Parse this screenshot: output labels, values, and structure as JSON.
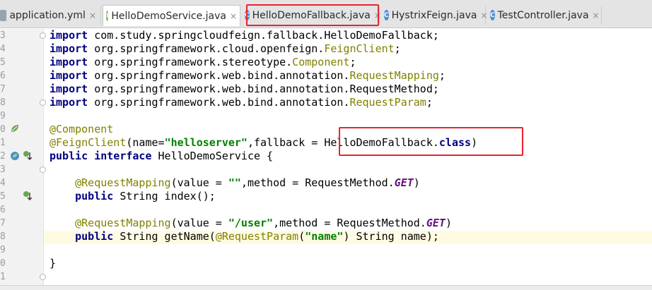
{
  "tabs": [
    {
      "label": "application.yml",
      "icon": "yml-file-icon"
    },
    {
      "label": "HelloDemoService.java",
      "icon": "interface-icon",
      "active": true
    },
    {
      "label": "HelloDemoFallback.java",
      "icon": "class-icon"
    },
    {
      "label": "HystrixFeign.java",
      "icon": "class-icon"
    },
    {
      "label": "TestController.java",
      "icon": "class-icon"
    }
  ],
  "close_glyph": "×",
  "highlight_color": "#e8242f",
  "gutter": {
    "line_numbers": [
      "3",
      "4",
      "5",
      "6",
      "7",
      "8",
      "9",
      "0",
      "1",
      "2",
      "3",
      "4",
      "5",
      "6",
      "7",
      "8",
      "9",
      "0",
      "1"
    ]
  },
  "code": {
    "line1": {
      "kw": "import",
      "rest": " com.study.springcloudfeign.fallback.HelloDemoFallback;"
    },
    "line2": {
      "kw": "import",
      "pre": " org.springframework.cloud.openfeign.",
      "ann": "FeignClient",
      "post": ";"
    },
    "line3": {
      "kw": "import",
      "pre": " org.springframework.stereotype.",
      "ann": "Component",
      "post": ";"
    },
    "line4": {
      "kw": "import",
      "pre": " org.springframework.web.bind.annotation.",
      "ann": "RequestMapping",
      "post": ";"
    },
    "line5": {
      "kw": "import",
      "rest": " org.springframework.web.bind.annotation.RequestMethod;"
    },
    "line6": {
      "kw": "import",
      "pre": " org.springframework.web.bind.annotation.",
      "ann": "RequestParam",
      "post": ";"
    },
    "line8": {
      "ann": "@Component"
    },
    "line9": {
      "ann": "@FeignClient",
      "a": "(name=",
      "str": "\"helloserver\"",
      "b": ",fallback = HelloDemoFallback.",
      "kw": "class",
      "c": ")"
    },
    "line10": {
      "kw1": "public",
      "sp": " ",
      "kw2": "interface",
      "rest": " HelloDemoService {"
    },
    "line12": {
      "indent": "    ",
      "ann": "@RequestMapping",
      "a": "(value = ",
      "str": "\"\"",
      "b": ",method = RequestMethod.",
      "cst": "GET",
      "c": ")"
    },
    "line13": {
      "indent": "    ",
      "kw": "public",
      "rest": " String index();"
    },
    "line15": {
      "indent": "    ",
      "ann": "@RequestMapping",
      "a": "(value = ",
      "str": "\"/user\"",
      "b": ",method = RequestMethod.",
      "cst": "GET",
      "c": ")"
    },
    "line16": {
      "indent": "    ",
      "kw": "public",
      "a": " String getName(",
      "ann": "@RequestParam",
      "b": "(",
      "str": "\"name\"",
      "c": ") String name);"
    },
    "line18": {
      "rest": "}"
    }
  }
}
